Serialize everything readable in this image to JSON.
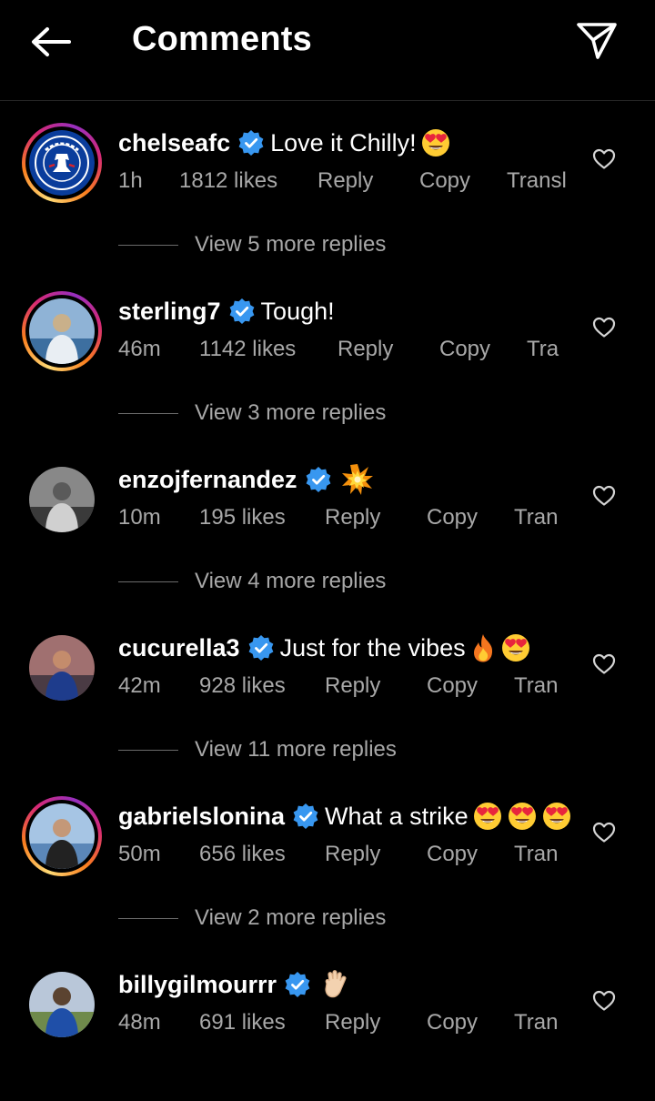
{
  "header": {
    "title": "Comments"
  },
  "comments": [
    {
      "username": "chelseafc",
      "text": "Love it Chilly!",
      "emojis": [
        "heart-eyes"
      ],
      "time": "1h",
      "likes": "1812 likes",
      "reply": "Reply",
      "copy": "Copy",
      "translate": "Transl",
      "view_replies": "View 5 more replies",
      "avatar": "chelsea-crest",
      "story_ring": true
    },
    {
      "username": "sterling7",
      "text": "Tough!",
      "emojis": [],
      "time": "46m",
      "likes": "1142 likes",
      "reply": "Reply",
      "copy": "Copy",
      "translate": "Tra",
      "view_replies": "View 3 more replies",
      "avatar": "person-photo",
      "story_ring": true
    },
    {
      "username": "enzojfernandez",
      "text": "",
      "emojis": [
        "collision"
      ],
      "time": "10m",
      "likes": "195 likes",
      "reply": "Reply",
      "copy": "Copy",
      "translate": "Tran",
      "view_replies": "View 4 more replies",
      "avatar": "person-photo",
      "story_ring": false
    },
    {
      "username": "cucurella3",
      "text": "Just for the vibes",
      "emojis": [
        "fire",
        "heart-eyes"
      ],
      "time": "42m",
      "likes": "928 likes",
      "reply": "Reply",
      "copy": "Copy",
      "translate": "Tran",
      "view_replies": "View 11 more replies",
      "avatar": "person-photo",
      "story_ring": false
    },
    {
      "username": "gabrielslonina",
      "text": "What a strike",
      "emojis": [
        "heart-eyes",
        "heart-eyes",
        "heart-eyes"
      ],
      "time": "50m",
      "likes": "656 likes",
      "reply": "Reply",
      "copy": "Copy",
      "translate": "Tran",
      "view_replies": "View 2 more replies",
      "avatar": "person-photo",
      "story_ring": true
    },
    {
      "username": "billygilmourrr",
      "text": "",
      "emojis": [
        "waving-hand"
      ],
      "time": "48m",
      "likes": "691 likes",
      "reply": "Reply",
      "copy": "Copy",
      "translate": "Tran",
      "view_replies": "",
      "avatar": "person-photo",
      "story_ring": false
    }
  ],
  "colors": {
    "background": "#000000",
    "text": "#ffffff",
    "secondary_text": "#a8a8a8",
    "verified": "#3897f0"
  },
  "icons": {
    "back": "arrow-left-icon",
    "send": "paper-plane-icon",
    "like": "heart-outline-icon",
    "verified": "verified-badge-icon"
  }
}
